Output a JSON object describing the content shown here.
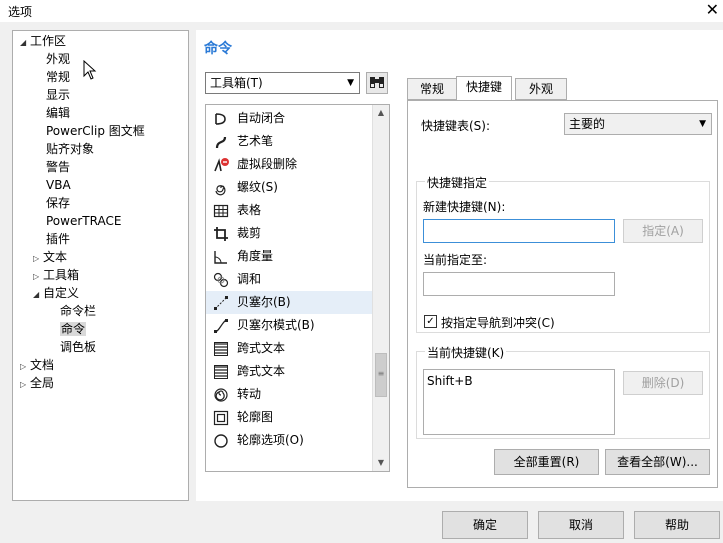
{
  "window": {
    "title": "选项",
    "close_glyph": "✕"
  },
  "tree": {
    "items": [
      {
        "label": "工作区",
        "arrow": "◢",
        "sel": false
      },
      {
        "label": "外观",
        "arrow": "",
        "sel": false
      },
      {
        "label": "常规",
        "arrow": "",
        "sel": false
      },
      {
        "label": "显示",
        "arrow": "",
        "sel": false
      },
      {
        "label": "编辑",
        "arrow": "",
        "sel": false
      },
      {
        "label": "PowerClip 图文框",
        "arrow": "",
        "sel": false
      },
      {
        "label": "贴齐对象",
        "arrow": "",
        "sel": false
      },
      {
        "label": "警告",
        "arrow": "",
        "sel": false
      },
      {
        "label": "VBA",
        "arrow": "",
        "sel": false
      },
      {
        "label": "保存",
        "arrow": "",
        "sel": false
      },
      {
        "label": "PowerTRACE",
        "arrow": "",
        "sel": false
      },
      {
        "label": "插件",
        "arrow": "",
        "sel": false
      },
      {
        "label": "文本",
        "arrow": "▷",
        "sel": false
      },
      {
        "label": "工具箱",
        "arrow": "▷",
        "sel": false
      },
      {
        "label": "自定义",
        "arrow": "◢",
        "sel": false
      },
      {
        "label": "命令栏",
        "arrow": "",
        "sel": false
      },
      {
        "label": "命令",
        "arrow": "",
        "sel": true
      },
      {
        "label": "调色板",
        "arrow": "",
        "sel": false
      },
      {
        "label": "文档",
        "arrow": "▷",
        "sel": false
      },
      {
        "label": "全局",
        "arrow": "▷",
        "sel": false
      }
    ]
  },
  "main": {
    "heading": "命令",
    "category_combo": "工具箱(T)",
    "commands": [
      {
        "label": "自动闭合",
        "icon": "auto-close-icon"
      },
      {
        "label": "艺术笔",
        "icon": "artistic-pen-icon"
      },
      {
        "label": "虚拟段删除",
        "icon": "virtual-segment-delete-icon"
      },
      {
        "label": "螺纹(S)",
        "icon": "spiral-icon"
      },
      {
        "label": "表格",
        "icon": "table-icon"
      },
      {
        "label": "裁剪",
        "icon": "crop-icon"
      },
      {
        "label": "角度量",
        "icon": "angle-measure-icon"
      },
      {
        "label": "调和",
        "icon": "blend-icon"
      },
      {
        "label": "贝塞尔(B)",
        "icon": "bezier-icon"
      },
      {
        "label": "贝塞尔模式(B)",
        "icon": "bezier-mode-icon"
      },
      {
        "label": "跨式文本",
        "icon": "span-text-icon"
      },
      {
        "label": "跨式文本",
        "icon": "span-text-icon"
      },
      {
        "label": "转动",
        "icon": "twirl-icon"
      },
      {
        "label": "轮廓图",
        "icon": "contour-icon"
      },
      {
        "label": "轮廓选项(O)",
        "icon": "outline-options-icon"
      }
    ],
    "selected_command_index": 8
  },
  "tabs": [
    {
      "label": "常规",
      "active": false
    },
    {
      "label": "快捷键",
      "active": true
    },
    {
      "label": "外观",
      "active": false
    }
  ],
  "shortcuts": {
    "table_label": "快捷键表(S):",
    "table_value": "主要的",
    "assign_group": "快捷键指定",
    "new_shortcut_label": "新建快捷键(N):",
    "new_shortcut_value": "",
    "assign_button": "指定(A)",
    "current_assigned_label": "当前指定至:",
    "current_assigned_value": "",
    "nav_conflict_label": "按指定导航到冲突(C)",
    "nav_conflict_checked": true,
    "current_group": "当前快捷键(K)",
    "current_keys": [
      "Shift+B"
    ],
    "delete_button": "删除(D)",
    "reset_all_button": "全部重置(R)",
    "view_all_button": "查看全部(W)..."
  },
  "footer": {
    "ok": "确定",
    "cancel": "取消",
    "help": "帮助"
  }
}
